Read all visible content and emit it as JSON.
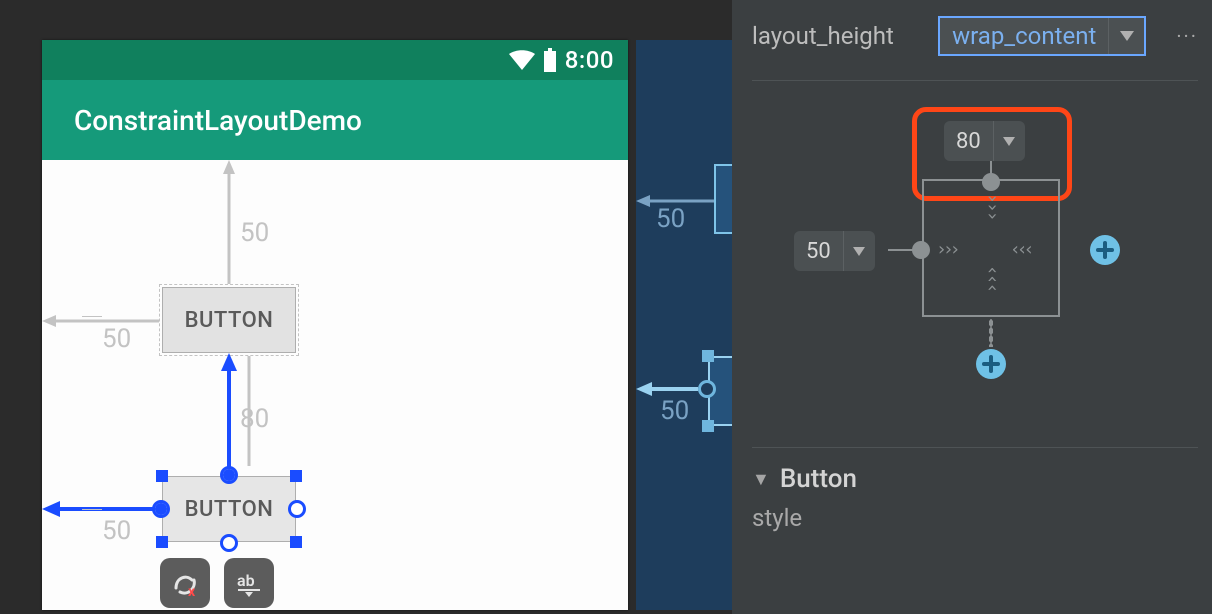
{
  "statusbar": {
    "time": "8:00"
  },
  "appbar": {
    "title": "ConstraintLayoutDemo"
  },
  "widgets": {
    "button1": {
      "label": "BUTTON",
      "margin_top": "50",
      "margin_left": "50"
    },
    "button2": {
      "label": "BUTTON",
      "margin_top": "80",
      "margin_left": "50"
    }
  },
  "blueprint": {
    "button1": {
      "margin_left": "50"
    },
    "button2": {
      "margin_left": "50"
    }
  },
  "attributes": {
    "layout_height": {
      "label": "layout_height",
      "value": "wrap_content"
    },
    "section_button": "Button",
    "style_label": "style"
  },
  "inspector": {
    "margin_top": "80",
    "margin_left": "50"
  }
}
